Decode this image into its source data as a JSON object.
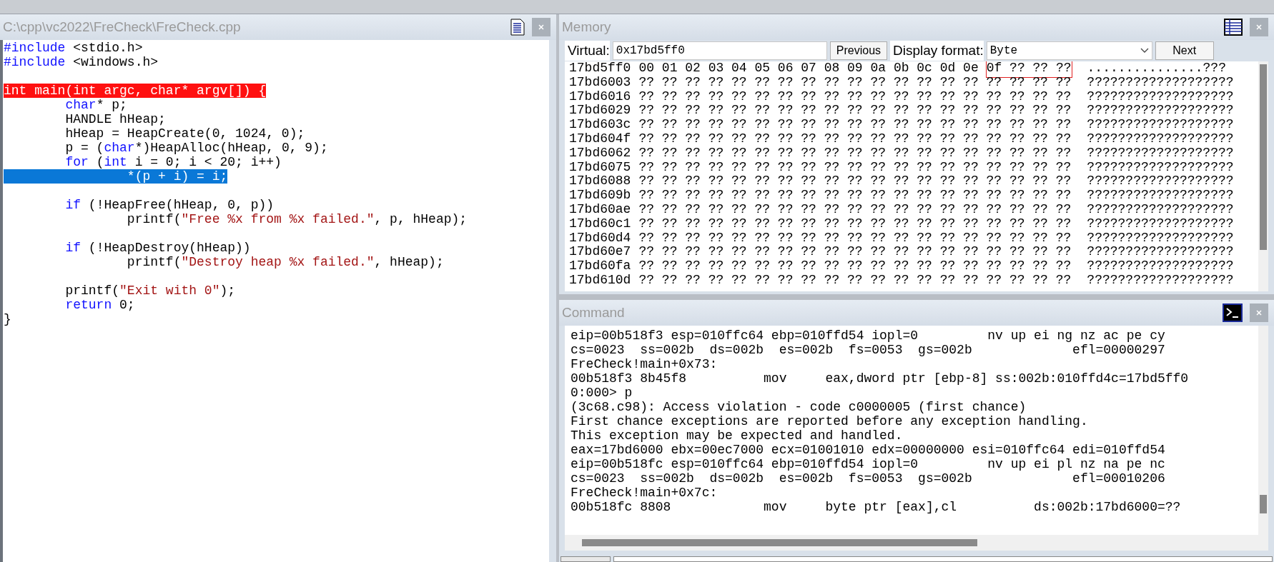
{
  "source_pane": {
    "title": "C:\\cpp\\vc2022\\FreCheck\\FreCheck.cpp",
    "lines": [
      {
        "kind": "code",
        "segments": [
          {
            "kind": "keyword",
            "text": "#include"
          },
          {
            "kind": "plain",
            "text": " <stdio.h>"
          }
        ]
      },
      {
        "kind": "code",
        "segments": [
          {
            "kind": "keyword",
            "text": "#include"
          },
          {
            "kind": "plain",
            "text": " <windows.h>"
          }
        ]
      },
      {
        "kind": "blank"
      },
      {
        "kind": "breakpoint",
        "text": "int main(int argc, char* argv[]) {"
      },
      {
        "kind": "code",
        "segments": [
          {
            "kind": "keyword",
            "text": "        char"
          },
          {
            "kind": "plain",
            "text": "* p;"
          }
        ]
      },
      {
        "kind": "code",
        "segments": [
          {
            "kind": "plain",
            "text": "        HANDLE hHeap;"
          }
        ]
      },
      {
        "kind": "code",
        "segments": [
          {
            "kind": "plain",
            "text": "        hHeap = HeapCreate(0, 1024, 0);"
          }
        ]
      },
      {
        "kind": "code",
        "segments": [
          {
            "kind": "plain",
            "text": "        p = ("
          },
          {
            "kind": "keyword",
            "text": "char"
          },
          {
            "kind": "plain",
            "text": "*)HeapAlloc(hHeap, 0, 9);"
          }
        ]
      },
      {
        "kind": "code",
        "segments": [
          {
            "kind": "keyword",
            "text": "        for"
          },
          {
            "kind": "plain",
            "text": " ("
          },
          {
            "kind": "keyword",
            "text": "int"
          },
          {
            "kind": "plain",
            "text": " i = 0; i < 20; i++)"
          }
        ]
      },
      {
        "kind": "current",
        "text": "                *(p + i) = i;"
      },
      {
        "kind": "blank"
      },
      {
        "kind": "code",
        "segments": [
          {
            "kind": "keyword",
            "text": "        if"
          },
          {
            "kind": "plain",
            "text": " (!HeapFree(hHeap, 0, p))"
          }
        ]
      },
      {
        "kind": "code",
        "segments": [
          {
            "kind": "plain",
            "text": "                printf("
          },
          {
            "kind": "string",
            "text": "\"Free %x from %x failed.\""
          },
          {
            "kind": "plain",
            "text": ", p, hHeap);"
          }
        ]
      },
      {
        "kind": "blank"
      },
      {
        "kind": "code",
        "segments": [
          {
            "kind": "keyword",
            "text": "        if"
          },
          {
            "kind": "plain",
            "text": " (!HeapDestroy(hHeap))"
          }
        ]
      },
      {
        "kind": "code",
        "segments": [
          {
            "kind": "plain",
            "text": "                printf("
          },
          {
            "kind": "string",
            "text": "\"Destroy heap %x failed.\""
          },
          {
            "kind": "plain",
            "text": ", hHeap);"
          }
        ]
      },
      {
        "kind": "blank"
      },
      {
        "kind": "code",
        "segments": [
          {
            "kind": "plain",
            "text": "        printf("
          },
          {
            "kind": "string",
            "text": "\"Exit with 0\""
          },
          {
            "kind": "plain",
            "text": ");"
          }
        ]
      },
      {
        "kind": "code",
        "segments": [
          {
            "kind": "keyword",
            "text": "        return"
          },
          {
            "kind": "plain",
            "text": " 0;"
          }
        ]
      },
      {
        "kind": "code",
        "segments": [
          {
            "kind": "plain",
            "text": "}"
          }
        ]
      }
    ]
  },
  "memory_pane": {
    "title": "Memory",
    "virtual_label": "Virtual:",
    "virtual_value": "0x17bd5ff0",
    "previous_button": "Previous",
    "format_label": "Display format:",
    "format_value": "Byte",
    "next_button": "Next",
    "rows": [
      {
        "address": "17bd5ff0",
        "bytes": "00 01 02 03 04 05 06 07 08 09 0a 0b 0c 0d 0e",
        "boxed_bytes": "0f ?? ?? ??",
        "ascii": "...............???"
      },
      {
        "address": "17bd6003",
        "bytes": "?? ?? ?? ?? ?? ?? ?? ?? ?? ?? ?? ?? ?? ?? ?? ?? ?? ?? ??",
        "ascii": "???????????????????"
      },
      {
        "address": "17bd6016",
        "bytes": "?? ?? ?? ?? ?? ?? ?? ?? ?? ?? ?? ?? ?? ?? ?? ?? ?? ?? ??",
        "ascii": "???????????????????"
      },
      {
        "address": "17bd6029",
        "bytes": "?? ?? ?? ?? ?? ?? ?? ?? ?? ?? ?? ?? ?? ?? ?? ?? ?? ?? ??",
        "ascii": "???????????????????"
      },
      {
        "address": "17bd603c",
        "bytes": "?? ?? ?? ?? ?? ?? ?? ?? ?? ?? ?? ?? ?? ?? ?? ?? ?? ?? ??",
        "ascii": "???????????????????"
      },
      {
        "address": "17bd604f",
        "bytes": "?? ?? ?? ?? ?? ?? ?? ?? ?? ?? ?? ?? ?? ?? ?? ?? ?? ?? ??",
        "ascii": "???????????????????"
      },
      {
        "address": "17bd6062",
        "bytes": "?? ?? ?? ?? ?? ?? ?? ?? ?? ?? ?? ?? ?? ?? ?? ?? ?? ?? ??",
        "ascii": "???????????????????"
      },
      {
        "address": "17bd6075",
        "bytes": "?? ?? ?? ?? ?? ?? ?? ?? ?? ?? ?? ?? ?? ?? ?? ?? ?? ?? ??",
        "ascii": "???????????????????"
      },
      {
        "address": "17bd6088",
        "bytes": "?? ?? ?? ?? ?? ?? ?? ?? ?? ?? ?? ?? ?? ?? ?? ?? ?? ?? ??",
        "ascii": "???????????????????"
      },
      {
        "address": "17bd609b",
        "bytes": "?? ?? ?? ?? ?? ?? ?? ?? ?? ?? ?? ?? ?? ?? ?? ?? ?? ?? ??",
        "ascii": "???????????????????"
      },
      {
        "address": "17bd60ae",
        "bytes": "?? ?? ?? ?? ?? ?? ?? ?? ?? ?? ?? ?? ?? ?? ?? ?? ?? ?? ??",
        "ascii": "???????????????????"
      },
      {
        "address": "17bd60c1",
        "bytes": "?? ?? ?? ?? ?? ?? ?? ?? ?? ?? ?? ?? ?? ?? ?? ?? ?? ?? ??",
        "ascii": "???????????????????"
      },
      {
        "address": "17bd60d4",
        "bytes": "?? ?? ?? ?? ?? ?? ?? ?? ?? ?? ?? ?? ?? ?? ?? ?? ?? ?? ??",
        "ascii": "???????????????????"
      },
      {
        "address": "17bd60e7",
        "bytes": "?? ?? ?? ?? ?? ?? ?? ?? ?? ?? ?? ?? ?? ?? ?? ?? ?? ?? ??",
        "ascii": "???????????????????"
      },
      {
        "address": "17bd60fa",
        "bytes": "?? ?? ?? ?? ?? ?? ?? ?? ?? ?? ?? ?? ?? ?? ?? ?? ?? ?? ??",
        "ascii": "???????????????????"
      },
      {
        "address": "17bd610d",
        "bytes": "?? ?? ?? ?? ?? ?? ?? ?? ?? ?? ?? ?? ?? ?? ?? ?? ?? ?? ??",
        "ascii": "???????????????????"
      }
    ]
  },
  "command_pane": {
    "title": "Command",
    "lines": [
      "eip=00b518f3 esp=010ffc64 ebp=010ffd54 iopl=0         nv up ei ng nz ac pe cy",
      "cs=0023  ss=002b  ds=002b  es=002b  fs=0053  gs=002b             efl=00000297",
      "FreCheck!main+0x73:",
      "00b518f3 8b45f8          mov     eax,dword ptr [ebp-8] ss:002b:010ffd4c=17bd5ff0",
      "0:000> p",
      "(3c68.c98): Access violation - code c0000005 (first chance)",
      "First chance exceptions are reported before any exception handling.",
      "This exception may be expected and handled.",
      "eax=17bd6000 ebx=00ec7000 ecx=01001010 edx=00000000 esi=010ffc64 edi=010ffd54",
      "eip=00b518fc esp=010ffc64 ebp=010ffd54 iopl=0         nv up ei pl nz na pe nc",
      "cs=0023  ss=002b  ds=002b  es=002b  fs=0053  gs=002b             efl=00010206",
      "FreCheck!main+0x7c:",
      "00b518fc 8808            mov     byte ptr [eax],cl          ds:002b:17bd6000=??"
    ]
  }
}
